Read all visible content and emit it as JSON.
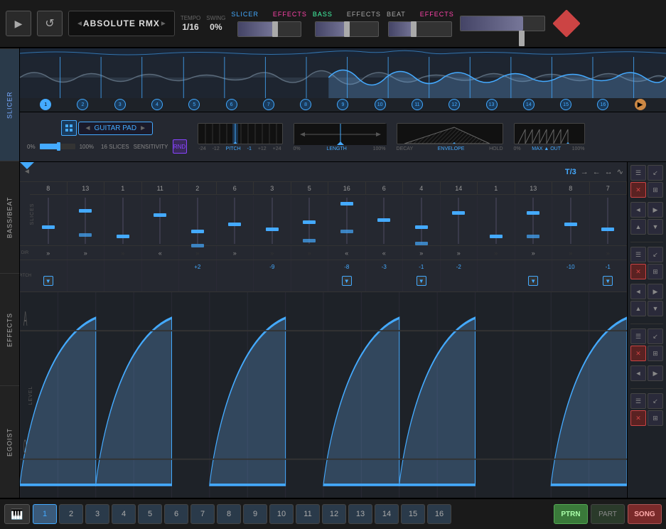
{
  "app": {
    "title": "ABSOLUTE RMX"
  },
  "transport": {
    "play_label": "▶",
    "loop_label": "↺",
    "tempo_label": "TEMPO",
    "tempo_value": "1/16",
    "swing_label": "SWING",
    "swing_value": "0%"
  },
  "sections": {
    "slicer": {
      "label": "SLICER",
      "effects_label": "EFFECTS"
    },
    "bass": {
      "label": "BASS",
      "effects_label": "EFFECTS"
    },
    "beat": {
      "label": "BEAT",
      "effects_label": "EFFECTS"
    }
  },
  "left_tabs": [
    {
      "id": "slicer",
      "label": "SLICER"
    },
    {
      "id": "bass_beat",
      "label": "BASS/BEAT"
    },
    {
      "id": "effects",
      "label": "EFFECTS"
    },
    {
      "id": "egoist",
      "label": "EGOIST"
    }
  ],
  "slicer_controls": {
    "preset": "GUITAR PAD",
    "slices": "16 SLICES",
    "pct_left": "0%",
    "pct_right": "100%",
    "sensitivity_label": "SENSITIVITY",
    "rnd_label": "RND",
    "pitch_label": "PITCH",
    "pitch_value": "-1",
    "pitch_min": "-24",
    "pitch_mid_left": "-12",
    "pitch_mid_right": "+12",
    "pitch_max": "+24",
    "length_label": "LENGTH",
    "length_pct_left": "0%",
    "length_pct_right": "100%",
    "decay_label": "DECAY",
    "hold_label": "HOLD",
    "envelope_label": "ENVELOPE",
    "maxout_label": "MAX ▲ OUT",
    "maxout_pct_left": "0%",
    "maxout_pct_right": "100%"
  },
  "sequencer": {
    "timing": "T/3",
    "slice_numbers": [
      8,
      13,
      1,
      11,
      2,
      6,
      3,
      5,
      16,
      6,
      4,
      14,
      1,
      13,
      8,
      7
    ],
    "fader_heights": [
      40,
      75,
      20,
      65,
      30,
      45,
      35,
      50,
      90,
      55,
      40,
      70,
      20,
      70,
      45,
      35
    ],
    "dir_values": [
      "»",
      "»",
      "",
      "«",
      "",
      "»",
      "",
      "",
      "«",
      "«",
      "»",
      "»",
      "",
      "»",
      "",
      ""
    ],
    "pitch_values": [
      "",
      "",
      "",
      "",
      "+2",
      "",
      "-9",
      "",
      "-8",
      "-3",
      "-1",
      "-2",
      "",
      "",
      "-10",
      "-1"
    ],
    "pitch_arrows": [
      true,
      false,
      false,
      false,
      false,
      false,
      false,
      false,
      true,
      false,
      true,
      false,
      false,
      true,
      false,
      true
    ]
  },
  "right_panel": {
    "buttons": [
      "☰",
      "↙",
      "✕",
      "⊞",
      "◄",
      "▶",
      "▲",
      "▼"
    ]
  },
  "bottom": {
    "keyboard_icon": "🎹",
    "steps": [
      1,
      2,
      3,
      4,
      5,
      6,
      7,
      8,
      9,
      10,
      11,
      12,
      13,
      14,
      15,
      16
    ],
    "active_step": 1,
    "ptrn_label": "PTRN",
    "part_label": "PART",
    "song_label": "SONG"
  }
}
